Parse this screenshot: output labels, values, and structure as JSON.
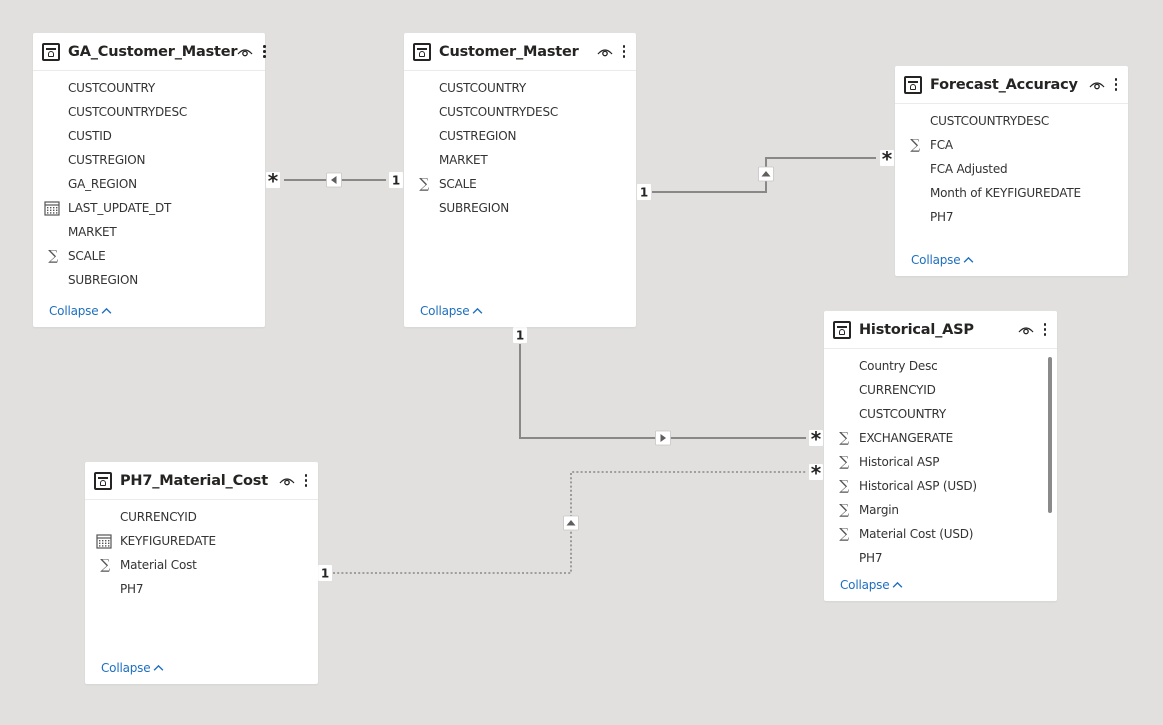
{
  "canvas_bg": "#e1e0df",
  "collapse_label": "Collapse",
  "tables": [
    {
      "id": "ga_customer_master",
      "name": "GA_Customer_Master",
      "fields": [
        {
          "name": "CUSTCOUNTRY",
          "icon": ""
        },
        {
          "name": "CUSTCOUNTRYDESC",
          "icon": ""
        },
        {
          "name": "CUSTID",
          "icon": ""
        },
        {
          "name": "CUSTREGION",
          "icon": ""
        },
        {
          "name": "GA_REGION",
          "icon": ""
        },
        {
          "name": "LAST_UPDATE_DT",
          "icon": "calendar-icon"
        },
        {
          "name": "MARKET",
          "icon": ""
        },
        {
          "name": "SCALE",
          "icon": "sigma-icon"
        },
        {
          "name": "SUBREGION",
          "icon": ""
        }
      ]
    },
    {
      "id": "customer_master",
      "name": "Customer_Master",
      "fields": [
        {
          "name": "CUSTCOUNTRY",
          "icon": ""
        },
        {
          "name": "CUSTCOUNTRYDESC",
          "icon": ""
        },
        {
          "name": "CUSTREGION",
          "icon": ""
        },
        {
          "name": "MARKET",
          "icon": ""
        },
        {
          "name": "SCALE",
          "icon": "sigma-icon"
        },
        {
          "name": "SUBREGION",
          "icon": ""
        }
      ]
    },
    {
      "id": "forecast_accuracy",
      "name": "Forecast_Accuracy",
      "fields": [
        {
          "name": "CUSTCOUNTRYDESC",
          "icon": ""
        },
        {
          "name": "FCA",
          "icon": "sigma-icon"
        },
        {
          "name": "FCA Adjusted",
          "icon": ""
        },
        {
          "name": "Month of KEYFIGUREDATE",
          "icon": ""
        },
        {
          "name": "PH7",
          "icon": ""
        }
      ]
    },
    {
      "id": "historical_asp",
      "name": "Historical_ASP",
      "fields": [
        {
          "name": "Country Desc",
          "icon": ""
        },
        {
          "name": "CURRENCYID",
          "icon": ""
        },
        {
          "name": "CUSTCOUNTRY",
          "icon": ""
        },
        {
          "name": "EXCHANGERATE",
          "icon": "sigma-icon"
        },
        {
          "name": "Historical ASP",
          "icon": "sigma-icon"
        },
        {
          "name": "Historical ASP (USD)",
          "icon": "sigma-icon"
        },
        {
          "name": "Margin",
          "icon": "sigma-icon"
        },
        {
          "name": "Material Cost (USD)",
          "icon": "sigma-icon"
        },
        {
          "name": "PH7",
          "icon": ""
        }
      ]
    },
    {
      "id": "ph7_material_cost",
      "name": "PH7_Material_Cost",
      "fields": [
        {
          "name": "CURRENCYID",
          "icon": ""
        },
        {
          "name": "KEYFIGUREDATE",
          "icon": "calendar-icon"
        },
        {
          "name": "Material Cost",
          "icon": "sigma-icon"
        },
        {
          "name": "PH7",
          "icon": ""
        }
      ]
    }
  ],
  "relationships": [
    {
      "from": "ga_customer_master",
      "to": "customer_master",
      "from_cardinality": "*",
      "to_cardinality": "1",
      "filter_direction": "single",
      "active": true
    },
    {
      "from": "customer_master",
      "to": "forecast_accuracy",
      "from_cardinality": "1",
      "to_cardinality": "*",
      "filter_direction": "single",
      "active": true
    },
    {
      "from": "customer_master",
      "to": "historical_asp",
      "from_cardinality": "1",
      "to_cardinality": "*",
      "filter_direction": "single",
      "active": true
    },
    {
      "from": "ph7_material_cost",
      "to": "historical_asp",
      "from_cardinality": "1",
      "to_cardinality": "*",
      "filter_direction": "single",
      "active": false
    }
  ],
  "line_color": "#8a8886"
}
